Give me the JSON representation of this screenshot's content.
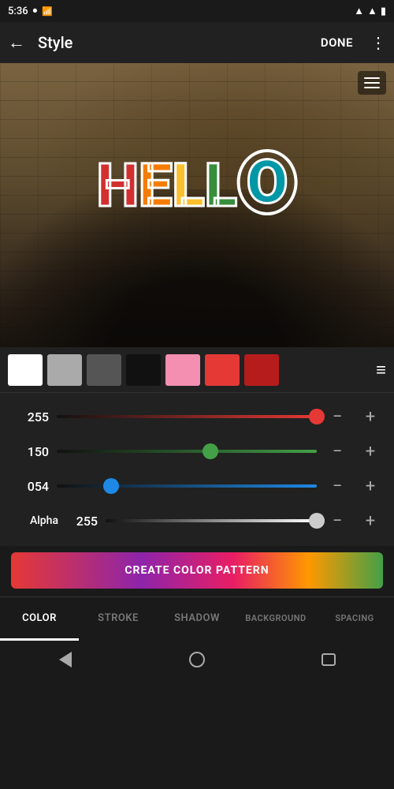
{
  "status": {
    "time": "5:36",
    "battery_icon": "battery",
    "signal_icon": "signal"
  },
  "header": {
    "back_icon": "←",
    "title": "Style",
    "done_label": "DONE",
    "more_icon": "⋮"
  },
  "image": {
    "hamburger_title": "menu"
  },
  "hello": {
    "letters": [
      "H",
      "E",
      "L",
      "L",
      "O"
    ],
    "colors": [
      "#d32f2f",
      "#f57c00",
      "#fbc02d",
      "#388e3c",
      "#0097a7"
    ]
  },
  "swatches": [
    {
      "id": "white",
      "color": "#ffffff"
    },
    {
      "id": "light-gray",
      "color": "#aaaaaa"
    },
    {
      "id": "dark-gray",
      "color": "#555555"
    },
    {
      "id": "black",
      "color": "#111111"
    },
    {
      "id": "pink",
      "color": "#f48fb1"
    },
    {
      "id": "red",
      "color": "#e53935"
    },
    {
      "id": "dark-red",
      "color": "#b71c1c"
    }
  ],
  "sliders": {
    "red": {
      "label": "255",
      "value": 255,
      "max": 255,
      "percent": 100
    },
    "green": {
      "label": "150",
      "value": 150,
      "max": 255,
      "percent": 59
    },
    "blue": {
      "label": "054",
      "value": 54,
      "max": 255,
      "percent": 21
    },
    "alpha": {
      "label": "255",
      "value": 255,
      "max": 255,
      "percent": 100,
      "prefix": "Alpha"
    }
  },
  "create_btn": {
    "label": "CREATE COLOR PATTERN"
  },
  "tabs": [
    {
      "id": "color",
      "label": "COLOR",
      "active": true
    },
    {
      "id": "stroke",
      "label": "STROKE",
      "active": false
    },
    {
      "id": "shadow",
      "label": "SHADOW",
      "active": false
    },
    {
      "id": "background",
      "label": "BACKGROUND",
      "active": false
    },
    {
      "id": "spacing",
      "label": "SPACING",
      "active": false
    }
  ],
  "navbar": {
    "back": "back",
    "home": "home",
    "recents": "recents"
  }
}
